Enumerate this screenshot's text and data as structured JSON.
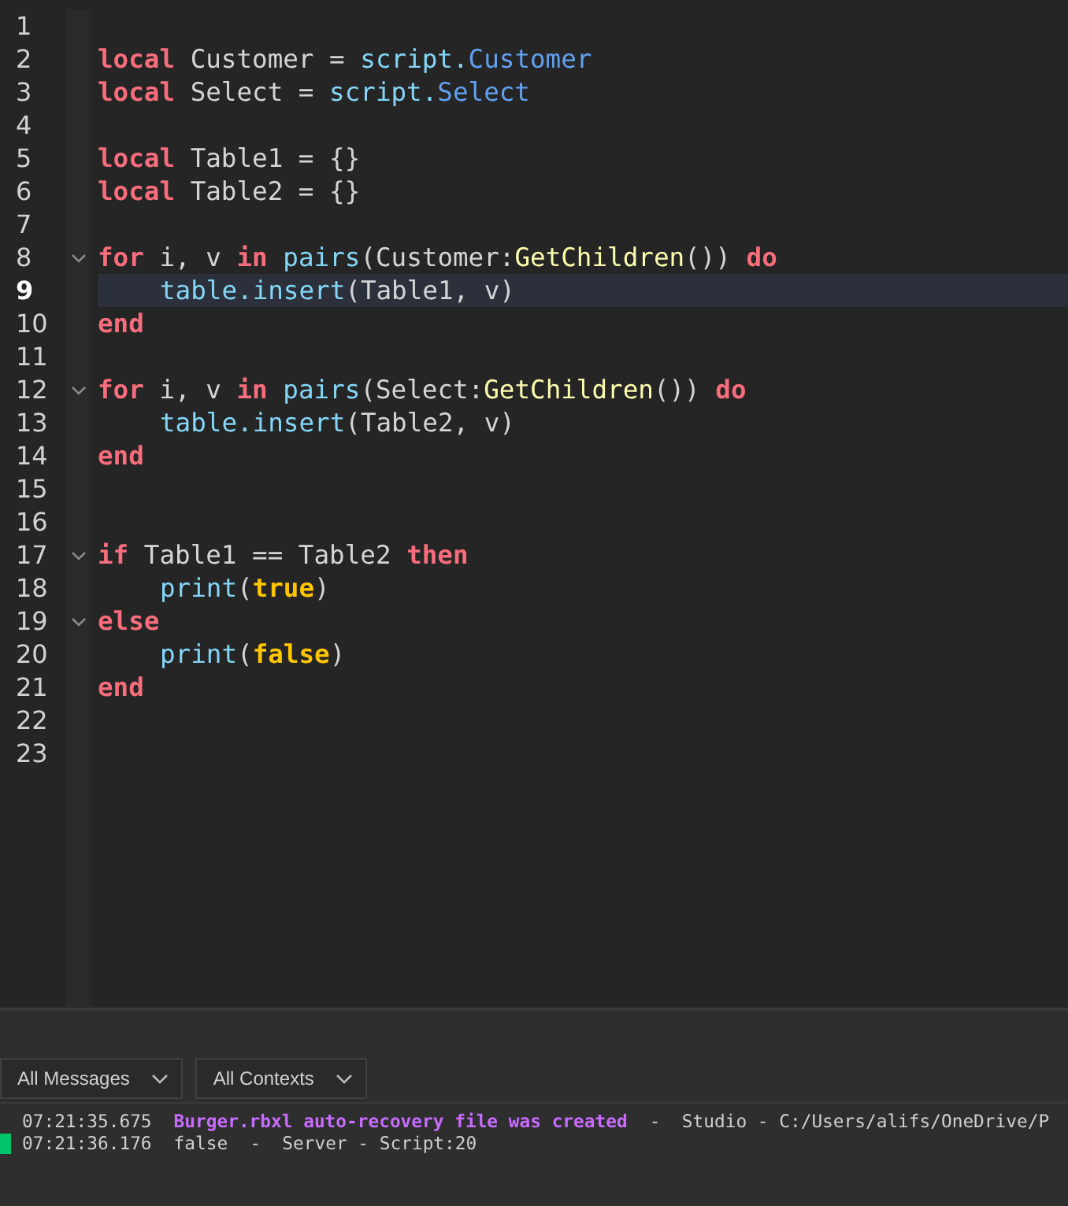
{
  "editor": {
    "lines": [
      {
        "number": "1",
        "fold": false,
        "current": false
      },
      {
        "number": "2",
        "fold": false,
        "current": false,
        "tokens": [
          {
            "kind": "keyword",
            "text": "local"
          },
          {
            "kind": "plain",
            "text": " Customer = "
          },
          {
            "kind": "builtin",
            "text": "script."
          },
          {
            "kind": "member",
            "text": "Customer"
          }
        ]
      },
      {
        "number": "3",
        "fold": false,
        "current": false,
        "tokens": [
          {
            "kind": "keyword",
            "text": "local"
          },
          {
            "kind": "plain",
            "text": " Select = "
          },
          {
            "kind": "builtin",
            "text": "script."
          },
          {
            "kind": "member",
            "text": "Select"
          }
        ]
      },
      {
        "number": "4",
        "fold": false,
        "current": false
      },
      {
        "number": "5",
        "fold": false,
        "current": false,
        "tokens": [
          {
            "kind": "keyword",
            "text": "local"
          },
          {
            "kind": "plain",
            "text": " Table1 = {}"
          }
        ]
      },
      {
        "number": "6",
        "fold": false,
        "current": false,
        "tokens": [
          {
            "kind": "keyword",
            "text": "local"
          },
          {
            "kind": "plain",
            "text": " Table2 = {}"
          }
        ]
      },
      {
        "number": "7",
        "fold": false,
        "current": false
      },
      {
        "number": "8",
        "fold": true,
        "current": false,
        "tokens": [
          {
            "kind": "keyword",
            "text": "for"
          },
          {
            "kind": "plain",
            "text": " i, v "
          },
          {
            "kind": "keyword",
            "text": "in"
          },
          {
            "kind": "builtin",
            "text": " pairs"
          },
          {
            "kind": "plain",
            "text": "(Customer:"
          },
          {
            "kind": "method",
            "text": "GetChildren"
          },
          {
            "kind": "plain",
            "text": "()) "
          },
          {
            "kind": "keyword",
            "text": "do"
          }
        ]
      },
      {
        "number": "9",
        "fold": false,
        "current": true,
        "indent": true,
        "tokens": [
          {
            "kind": "builtin",
            "text": "table.insert"
          },
          {
            "kind": "plain",
            "text": "(Table1, v)"
          }
        ]
      },
      {
        "number": "10",
        "fold": false,
        "current": false,
        "tokens": [
          {
            "kind": "keyword",
            "text": "end"
          }
        ]
      },
      {
        "number": "11",
        "fold": false,
        "current": false
      },
      {
        "number": "12",
        "fold": true,
        "current": false,
        "tokens": [
          {
            "kind": "keyword",
            "text": "for"
          },
          {
            "kind": "plain",
            "text": " i, v "
          },
          {
            "kind": "keyword",
            "text": "in"
          },
          {
            "kind": "builtin",
            "text": " pairs"
          },
          {
            "kind": "plain",
            "text": "(Select:"
          },
          {
            "kind": "method",
            "text": "GetChildren"
          },
          {
            "kind": "plain",
            "text": "()) "
          },
          {
            "kind": "keyword",
            "text": "do"
          }
        ]
      },
      {
        "number": "13",
        "fold": false,
        "current": false,
        "indent": true,
        "tokens": [
          {
            "kind": "builtin",
            "text": "table.insert"
          },
          {
            "kind": "plain",
            "text": "(Table2, v)"
          }
        ]
      },
      {
        "number": "14",
        "fold": false,
        "current": false,
        "tokens": [
          {
            "kind": "keyword",
            "text": "end"
          }
        ]
      },
      {
        "number": "15",
        "fold": false,
        "current": false
      },
      {
        "number": "16",
        "fold": false,
        "current": false
      },
      {
        "number": "17",
        "fold": true,
        "current": false,
        "tokens": [
          {
            "kind": "keyword",
            "text": "if"
          },
          {
            "kind": "plain",
            "text": " Table1 == Table2 "
          },
          {
            "kind": "keyword",
            "text": "then"
          }
        ]
      },
      {
        "number": "18",
        "fold": false,
        "current": false,
        "indent": true,
        "tokens": [
          {
            "kind": "builtin",
            "text": "print"
          },
          {
            "kind": "plain",
            "text": "("
          },
          {
            "kind": "bool",
            "text": "true"
          },
          {
            "kind": "plain",
            "text": ")"
          }
        ]
      },
      {
        "number": "19",
        "fold": true,
        "current": false,
        "tokens": [
          {
            "kind": "keyword",
            "text": "else"
          }
        ]
      },
      {
        "number": "20",
        "fold": false,
        "current": false,
        "indent": true,
        "tokens": [
          {
            "kind": "builtin",
            "text": "print"
          },
          {
            "kind": "plain",
            "text": "("
          },
          {
            "kind": "bool",
            "text": "false"
          },
          {
            "kind": "plain",
            "text": ")"
          }
        ]
      },
      {
        "number": "21",
        "fold": false,
        "current": false,
        "tokens": [
          {
            "kind": "keyword",
            "text": "end"
          }
        ]
      },
      {
        "number": "22",
        "fold": false,
        "current": false
      },
      {
        "number": "23",
        "fold": false,
        "current": false
      }
    ]
  },
  "output": {
    "filters": [
      "All Messages",
      "All Contexts"
    ],
    "messages": [
      {
        "kind": "info",
        "time": "07:21:35.675",
        "text": "Burger.rbxl auto-recovery file was created",
        "source": "-  Studio - C:/Users/alifs/OneDrive/P"
      },
      {
        "kind": "print",
        "time": "07:21:36.176",
        "text": "false",
        "source": "-  Server - Script:20"
      }
    ]
  }
}
